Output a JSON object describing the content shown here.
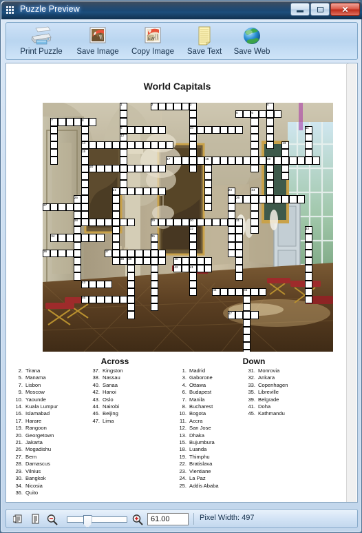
{
  "window": {
    "title": "Puzzle Preview",
    "app_icon": "puzzle-grid-icon",
    "buttons": {
      "minimize": "minimize-icon",
      "maximize": "maximize-icon",
      "close": "✕"
    }
  },
  "toolbar": {
    "items": [
      {
        "label": "Print Puzzle",
        "icon": "printer-icon"
      },
      {
        "label": "Save Image",
        "icon": "save-image-icon"
      },
      {
        "label": "Copy Image",
        "icon": "copy-image-icon"
      },
      {
        "label": "Save Text",
        "icon": "notepad-icon"
      },
      {
        "label": "Save Web",
        "icon": "globe-icon"
      }
    ]
  },
  "puzzle": {
    "title": "World Capitals",
    "grid_cols": 38,
    "grid_rows": 33,
    "background_image": "versailles-grand-trianon-gallery-photo",
    "across_heading": "Across",
    "down_heading": "Down",
    "across": [
      {
        "num": 2,
        "answer": "Tirana",
        "row": 0,
        "col": 14,
        "len": 6
      },
      {
        "num": 5,
        "answer": "Manama",
        "row": 1,
        "col": 25,
        "len": 6
      },
      {
        "num": 7,
        "answer": "Lisbon",
        "row": 2,
        "col": 1,
        "len": 6
      },
      {
        "num": 9,
        "answer": "Moscow",
        "row": 3,
        "col": 10,
        "len": 6
      },
      {
        "num": 10,
        "answer": "Yaounde",
        "row": 3,
        "col": 19,
        "len": 7
      },
      {
        "num": 14,
        "answer": "Kuala Lumpur",
        "row": 5,
        "col": 5,
        "len": 12
      },
      {
        "num": 16,
        "answer": "Islamabad",
        "row": 7,
        "col": 21,
        "len": 9
      },
      {
        "num": 17,
        "answer": "Harare",
        "row": 7,
        "col": 16,
        "len": 6
      },
      {
        "num": 19,
        "answer": "Rangoon",
        "row": 7,
        "col": 29,
        "len": 7
      },
      {
        "num": 20,
        "answer": "Georgetown",
        "row": 8,
        "col": 6,
        "len": 10
      },
      {
        "num": 21,
        "answer": "Jakarta",
        "row": 11,
        "col": 9,
        "len": 7
      },
      {
        "num": 26,
        "answer": "Mogadishu",
        "row": 12,
        "col": 25,
        "len": 9
      },
      {
        "num": 27,
        "answer": "Bern",
        "row": 13,
        "col": 0,
        "len": 4
      },
      {
        "num": 28,
        "answer": "Damascus",
        "row": 15,
        "col": 4,
        "len": 8
      },
      {
        "num": 29,
        "answer": "Vilnius",
        "row": 15,
        "col": 14,
        "len": 7
      },
      {
        "num": 30,
        "answer": "Bangkok",
        "row": 15,
        "col": 19,
        "len": 7
      },
      {
        "num": 34,
        "answer": "Nicosia",
        "row": 17,
        "col": 1,
        "len": 7
      },
      {
        "num": 36,
        "answer": "Quito",
        "row": 19,
        "col": 0,
        "len": 5
      },
      {
        "num": 37,
        "answer": "Kingston",
        "row": 19,
        "col": 8,
        "len": 8
      },
      {
        "num": 38,
        "answer": "Nassau",
        "row": 20,
        "col": 10,
        "len": 6
      },
      {
        "num": 40,
        "answer": "Sanaa",
        "row": 20,
        "col": 17,
        "len": 5
      },
      {
        "num": 42,
        "answer": "Hanoi",
        "row": 21,
        "col": 17,
        "len": 5
      },
      {
        "num": 43,
        "answer": "Oslo",
        "row": 23,
        "col": 5,
        "len": 4
      },
      {
        "num": 44,
        "answer": "Nairobi",
        "row": 24,
        "col": 22,
        "len": 7
      },
      {
        "num": 46,
        "answer": "Beijing",
        "row": 25,
        "col": 5,
        "len": 7
      },
      {
        "num": 47,
        "answer": "Lima",
        "row": 27,
        "col": 24,
        "len": 4
      }
    ],
    "down": [
      {
        "num": 1,
        "answer": "Madrid",
        "row": 0,
        "col": 10,
        "len": 6
      },
      {
        "num": 3,
        "answer": "Gaborone",
        "row": 0,
        "col": 19,
        "len": 8
      },
      {
        "num": 4,
        "answer": "Ottawa",
        "row": 0,
        "col": 29,
        "len": 6
      },
      {
        "num": 6,
        "answer": "Budapest",
        "row": 1,
        "col": 27,
        "len": 8
      },
      {
        "num": 7,
        "answer": "Manila",
        "row": 2,
        "col": 1,
        "len": 6
      },
      {
        "num": 8,
        "answer": "Bucharest",
        "row": 2,
        "col": 5,
        "len": 9
      },
      {
        "num": 10,
        "answer": "Bogota",
        "row": 3,
        "col": 19,
        "len": 6
      },
      {
        "num": 11,
        "answer": "Accra",
        "row": 3,
        "col": 34,
        "len": 5
      },
      {
        "num": 12,
        "answer": "San Jose",
        "row": 4,
        "col": 10,
        "len": 8
      },
      {
        "num": 13,
        "answer": "Dhaka",
        "row": 5,
        "col": 31,
        "len": 5
      },
      {
        "num": 15,
        "answer": "Bujumbura",
        "row": 6,
        "col": 5,
        "len": 9
      },
      {
        "num": 18,
        "answer": "Luanda",
        "row": 7,
        "col": 29,
        "len": 6
      },
      {
        "num": 19,
        "answer": "Thimphu",
        "row": 7,
        "col": 21,
        "len": 7
      },
      {
        "num": 22,
        "answer": "Bratislava",
        "row": 11,
        "col": 9,
        "len": 10
      },
      {
        "num": 23,
        "answer": "Vientiane",
        "row": 11,
        "col": 24,
        "len": 9
      },
      {
        "num": 24,
        "answer": "La Paz",
        "row": 11,
        "col": 27,
        "len": 6
      },
      {
        "num": 25,
        "answer": "Addis Ababa",
        "row": 12,
        "col": 4,
        "len": 11
      },
      {
        "num": 31,
        "answer": "Monrovia",
        "row": 15,
        "col": 25,
        "len": 8
      },
      {
        "num": 32,
        "answer": "Ankara",
        "row": 16,
        "col": 19,
        "len": 6
      },
      {
        "num": 33,
        "answer": "Copenhagen",
        "row": 16,
        "col": 34,
        "len": 10
      },
      {
        "num": 35,
        "answer": "Libreville",
        "row": 17,
        "col": 14,
        "len": 10
      },
      {
        "num": 39,
        "answer": "Belgrade",
        "row": 20,
        "col": 11,
        "len": 8
      },
      {
        "num": 41,
        "answer": "Doha",
        "row": 21,
        "col": 19,
        "len": 4
      },
      {
        "num": 45,
        "answer": "Kathmandu",
        "row": 24,
        "col": 26,
        "len": 9
      }
    ]
  },
  "statusbar": {
    "icons": [
      "fit-page-icon",
      "single-page-icon",
      "zoom-out-icon",
      "zoom-in-icon"
    ],
    "zoom_value": "61.00",
    "zoom_slider_percent": 30,
    "pixel_width_label": "Pixel Width: 497"
  },
  "colors": {
    "accent": "#1d4f7d",
    "toolbar_bg": "#b9d5f0",
    "close_button": "#bf2d1c",
    "cell_fill": "#ffffff",
    "cell_border": "#000000"
  }
}
